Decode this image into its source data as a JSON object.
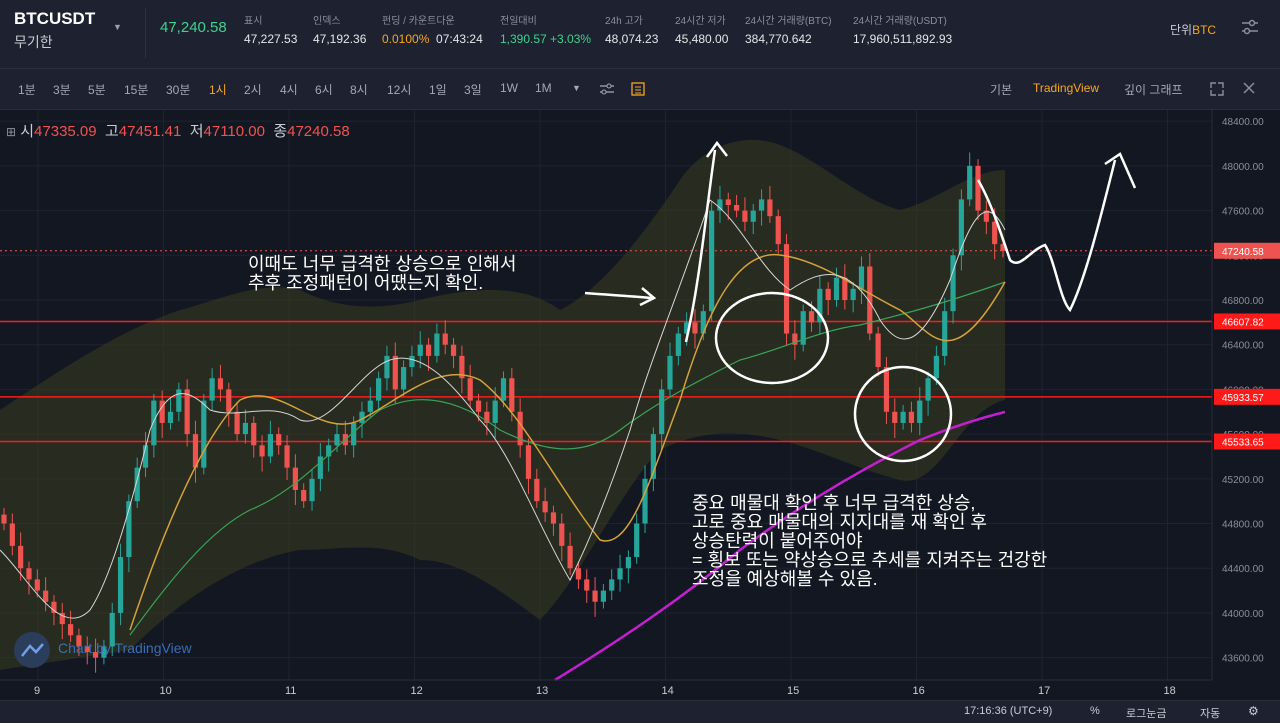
{
  "header": {
    "symbol": "BTCUSDT",
    "symbol_sub": "무기한",
    "last_price": "47,240.58",
    "stats": [
      {
        "label": "표시",
        "value": "47,227.53",
        "style": ""
      },
      {
        "label": "인덱스",
        "value": "47,192.36",
        "style": ""
      },
      {
        "label": "펀딩 / 카운트다운",
        "value": "0.0100%",
        "value2": "07:43:24",
        "style": "orange"
      },
      {
        "label": "전일대비",
        "value": "1,390.57 +3.03%",
        "style": "green"
      },
      {
        "label": "24h 고가",
        "value": "48,074.23",
        "style": ""
      },
      {
        "label": "24시간 저가",
        "value": "45,480.00",
        "style": ""
      },
      {
        "label": "24시간 거래량(BTC)",
        "value": "384,770.642",
        "style": ""
      },
      {
        "label": "24시간 거래량(USDT)",
        "value": "17,960,511,892.93",
        "style": ""
      }
    ],
    "unit_label": "단위",
    "unit_value": "BTC"
  },
  "toolbar": {
    "timeframes": [
      "1분",
      "3분",
      "5분",
      "15분",
      "30분",
      "1시",
      "2시",
      "4시",
      "6시",
      "8시",
      "12시",
      "1일",
      "3일",
      "1W",
      "1M"
    ],
    "active_timeframe": "1시",
    "right_tabs": [
      "기본",
      "TradingView",
      "깊이 그래프"
    ],
    "active_tab": "TradingView"
  },
  "ohlc": {
    "open_label": "시",
    "open": "47335.09",
    "high_label": "고",
    "high": "47451.41",
    "low_label": "저",
    "low": "47110.00",
    "close_label": "종",
    "close": "47240.58"
  },
  "chart_data": {
    "type": "candlestick",
    "x_ticks": [
      "9",
      "10",
      "11",
      "12",
      "13",
      "14",
      "15",
      "16",
      "17",
      "18"
    ],
    "y_ticks": [
      "43600.00",
      "44000.00",
      "44400.00",
      "44800.00",
      "45200.00",
      "45600.00",
      "46000.00",
      "46400.00",
      "46800.00",
      "47200.00",
      "47600.00",
      "48000.00",
      "48400.00"
    ],
    "ylim": [
      43400,
      48500
    ],
    "price_labels": [
      {
        "value": 47240.58,
        "text": "47240.58",
        "color": "#ef5350",
        "kind": "current"
      },
      {
        "value": 46607.82,
        "text": "46607.82",
        "color": "#ff1a1a",
        "kind": "level"
      },
      {
        "value": 45933.57,
        "text": "45933.57",
        "color": "#ff1a1a",
        "kind": "level"
      },
      {
        "value": 45533.65,
        "text": "45533.65",
        "color": "#ff1a1a",
        "kind": "level"
      }
    ],
    "series_close": [
      44800,
      44600,
      44400,
      44300,
      44200,
      44100,
      44000,
      43900,
      43800,
      43700,
      43650,
      43600,
      43700,
      44000,
      44500,
      45000,
      45300,
      45500,
      45900,
      45700,
      45800,
      46000,
      45600,
      45300,
      45900,
      46100,
      46000,
      45800,
      45600,
      45700,
      45500,
      45400,
      45600,
      45500,
      45300,
      45100,
      45000,
      45200,
      45400,
      45500,
      45600,
      45500,
      45700,
      45800,
      45900,
      46100,
      46300,
      46000,
      46200,
      46300,
      46400,
      46300,
      46500,
      46400,
      46300,
      46100,
      45900,
      45800,
      45700,
      45900,
      46100,
      45800,
      45500,
      45200,
      45000,
      44900,
      44800,
      44600,
      44400,
      44300,
      44200,
      44100,
      44200,
      44300,
      44400,
      44500,
      44800,
      45200,
      45600,
      46000,
      46300,
      46500,
      46600,
      46500,
      46700,
      47600,
      47700,
      47650,
      47600,
      47500,
      47600,
      47700,
      47550,
      47300,
      46500,
      46400,
      46700,
      46600,
      46900,
      46800,
      47000,
      46800,
      46900,
      47100,
      46500,
      46200,
      45800,
      45700,
      45800,
      45700,
      45900,
      46100,
      46300,
      46700,
      47200,
      47700,
      48000,
      47600,
      47500,
      47300,
      47240
    ],
    "ma_white_note": "short MA follows price",
    "colors": {
      "up": "#26a69a",
      "down": "#ef5350",
      "ma_orange": "#d4a23a",
      "ma_green": "#3aa35a",
      "ma_purple": "#c21fd0",
      "level": "#ff1a1a",
      "bands": "#3a3d1e"
    }
  },
  "annotations": {
    "note1": "이때도 너무 급격한 상승으로 인해서\n추후 조정패턴이 어땠는지 확인.",
    "note2": "중요 매물대 확인 후 너무 급격한 상승,\n고로 중요 매물대의 지지대를 재 확인 후\n상승탄력이 붙어주어야\n= 횡보 또는 약상승으로 추세를 지켜주는 건강한\n조정을 예상해볼 수 있음."
  },
  "watermark": "Chart by TradingView",
  "status": {
    "time": "17:16:36 (UTC+9)",
    "percent": "%",
    "log": "로그눈금",
    "auto": "자동"
  }
}
